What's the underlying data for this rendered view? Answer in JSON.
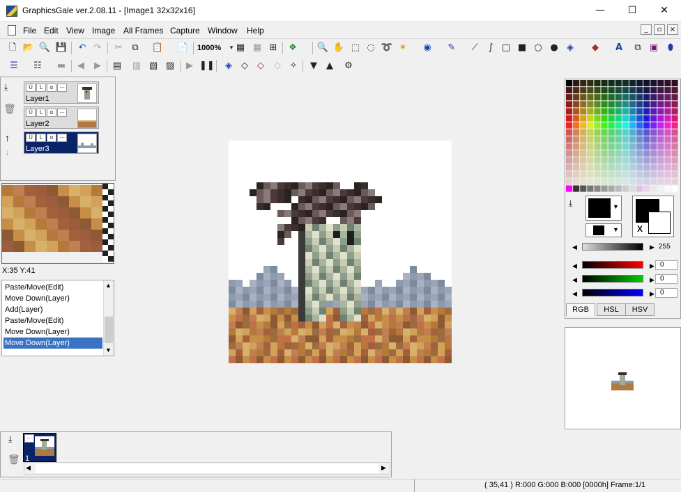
{
  "window": {
    "title": "GraphicsGale ver.2.08.11 - [Image1 32x32x16]",
    "minimize": "—",
    "maximize": "☐",
    "close": "✕"
  },
  "menu": [
    "File",
    "Edit",
    "View",
    "Image",
    "All Frames",
    "Capture",
    "Window",
    "Help"
  ],
  "mdi": {
    "minimize": "_",
    "restore": "▫",
    "close": "×"
  },
  "toolbar": {
    "zoom": "1000%"
  },
  "layers": [
    {
      "name": "Layer1",
      "selected": false
    },
    {
      "name": "Layer2",
      "selected": false
    },
    {
      "name": "Layer3",
      "selected": true
    }
  ],
  "preview": {
    "coords": "X:35 Y:41"
  },
  "history": [
    {
      "label": "Paste/Move(Edit)",
      "selected": false
    },
    {
      "label": "Move Down(Layer)",
      "selected": false
    },
    {
      "label": "Add(Layer)",
      "selected": false
    },
    {
      "label": "Paste/Move(Edit)",
      "selected": false
    },
    {
      "label": "Move Down(Layer)",
      "selected": false
    },
    {
      "label": "Move Down(Layer)",
      "selected": true
    }
  ],
  "color": {
    "alpha_value": "255",
    "r_value": "0",
    "g_value": "0",
    "b_value": "0",
    "tabs": [
      "RGB",
      "HSL",
      "HSV"
    ],
    "active_tab": "RGB",
    "swap_label": "X"
  },
  "frames": {
    "frame1_label": "1"
  },
  "status": {
    "text": "( 35,41 ) R:000 G:000 B:000 [0000h] Frame:1/1"
  }
}
